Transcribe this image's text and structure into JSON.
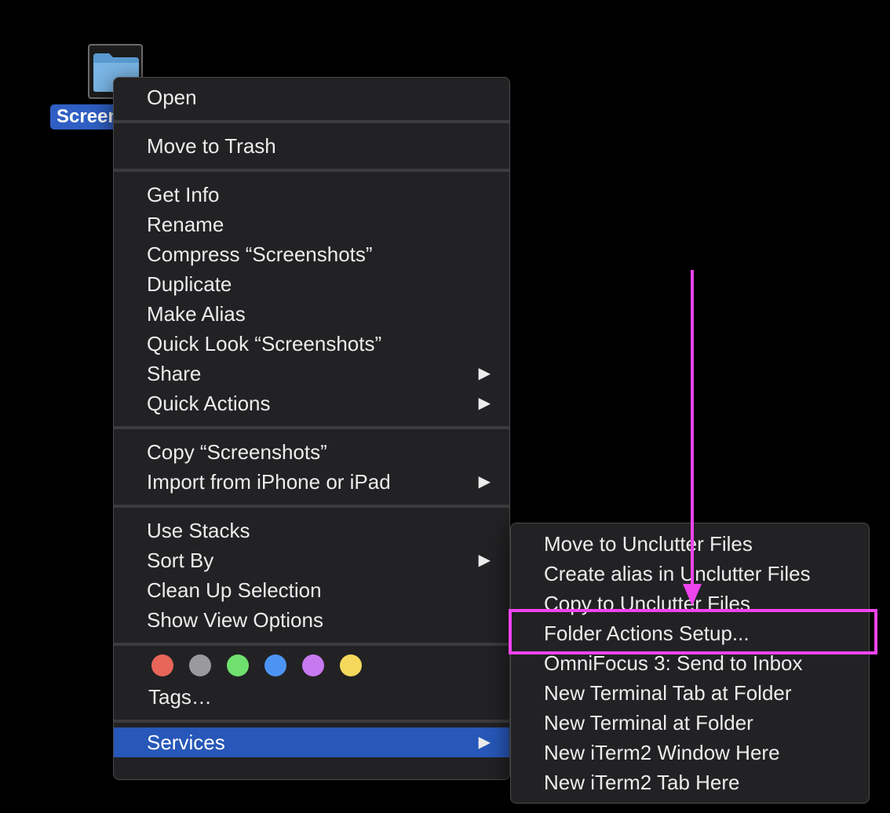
{
  "folder": {
    "label": "Screenshots",
    "icon": "folder-icon"
  },
  "context_menu": {
    "items": [
      {
        "label": "Open"
      },
      {
        "label": "Move to Trash"
      },
      {
        "label": "Get Info"
      },
      {
        "label": "Rename"
      },
      {
        "label": "Compress “Screenshots”"
      },
      {
        "label": "Duplicate"
      },
      {
        "label": "Make Alias"
      },
      {
        "label": "Quick Look “Screenshots”"
      },
      {
        "label": "Share",
        "submenu_arrow": "▶"
      },
      {
        "label": "Quick Actions",
        "submenu_arrow": "▶"
      },
      {
        "label": "Copy “Screenshots”"
      },
      {
        "label": "Import from iPhone or iPad",
        "submenu_arrow": "▶"
      },
      {
        "label": "Use Stacks"
      },
      {
        "label": "Sort By",
        "submenu_arrow": "▶"
      },
      {
        "label": "Clean Up Selection"
      },
      {
        "label": "Show View Options"
      },
      {
        "label": "Tags…"
      },
      {
        "label": "Services",
        "submenu_arrow": "▶",
        "highlighted": true
      }
    ],
    "tag_colors": [
      "#e8655a",
      "#9a9a9e",
      "#6fe06d",
      "#4c94f3",
      "#c779f0",
      "#f5d95c"
    ]
  },
  "services_submenu": {
    "items": [
      {
        "label": "Move to Unclutter Files"
      },
      {
        "label": "Create alias in Unclutter Files"
      },
      {
        "label": "Copy to Unclutter Files"
      },
      {
        "label": "Folder Actions Setup..."
      },
      {
        "label": "OmniFocus 3: Send to Inbox"
      },
      {
        "label": "New Terminal Tab at Folder"
      },
      {
        "label": "New Terminal at Folder"
      },
      {
        "label": "New iTerm2 Window Here"
      },
      {
        "label": "New iTerm2 Tab Here"
      }
    ]
  },
  "colors": {
    "highlight": "#2757b8",
    "annotation": "#ee44ee",
    "menu_bg": "#222224"
  }
}
